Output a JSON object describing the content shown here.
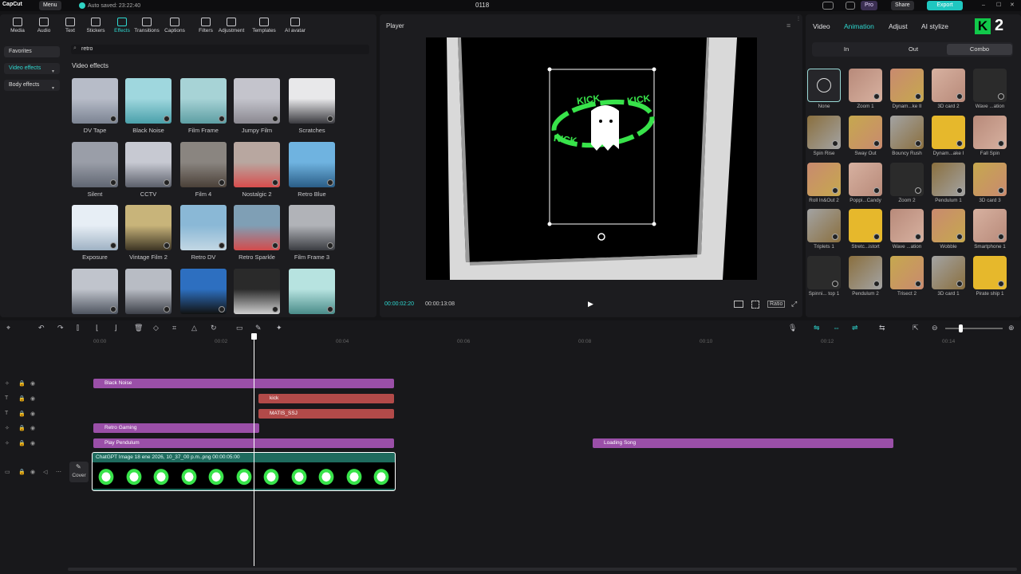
{
  "titlebar": {
    "app_name": "CapCut",
    "menu": "Menu",
    "autosave": "Auto saved: 23:22:40",
    "project": "0118",
    "pro": "Pro",
    "share": "Share",
    "export": "Export"
  },
  "toolbar": {
    "tools": [
      "Media",
      "Audio",
      "Text",
      "Stickers",
      "Effects",
      "Transitions",
      "Captions",
      "Filters",
      "Adjustment",
      "Templates",
      "AI avatar"
    ],
    "active": "Effects"
  },
  "effects_panel": {
    "sidebar": [
      "Favorites",
      "Video effects",
      "Body effects"
    ],
    "search_value": "retro",
    "section_title": "Video effects",
    "items": [
      "DV Tape",
      "Black Noise",
      "Film Frame",
      "Jumpy Film",
      "Scratches",
      "Silent",
      "CCTV",
      "Film 4",
      "Nostalgic 2",
      "Retro Blue",
      "Exposure",
      "Vintage Film 2",
      "Retro DV",
      "Retro Sparkle",
      "Film Frame 3"
    ]
  },
  "player": {
    "title": "Player",
    "current_time": "00:00:02:20",
    "total_time": "00:00:13:08",
    "ratio": "Ratio",
    "canvas_text": "KICK"
  },
  "right_panel": {
    "tabs": [
      "Video",
      "Animation",
      "Adjust",
      "AI stylize"
    ],
    "active_tab": "Animation",
    "subtabs": [
      "In",
      "Out",
      "Combo"
    ],
    "active_subtab": "Combo",
    "badge": "2",
    "animations": [
      "None",
      "Zoom 1",
      "Dynam...ke II",
      "3D card 2",
      "Wave ...ation",
      "Spin Rise",
      "Sway Out",
      "Bouncy Rush",
      "Dynam...ake I",
      "Fall Spin",
      "Roll In&Out 2",
      "Poppi...Candy",
      "Zoom 2",
      "Pendulum 1",
      "3D card 3",
      "Triplets 1",
      "Stretc...istort",
      "Wave ...ation",
      "Wobble",
      "Smartphone 1",
      "Spinni... top 1",
      "Pendulum 2",
      "Trisect 2",
      "3D card 1",
      "Pirate ship 1"
    ]
  },
  "timeline": {
    "ruler": [
      "00:00",
      "00:02",
      "00:04",
      "00:06",
      "00:08",
      "00:10",
      "00:12",
      "00:14"
    ],
    "cover": "Cover",
    "clips": {
      "black_noise": "Black Noise",
      "kick": "kick",
      "matis": "MATIS_SSJ",
      "retro_gaming": "Retro Gaming",
      "play_pendulum": "Play Pendulum",
      "loading_song": "Loading Song",
      "main_video": "ChatGPT Image 18 ene 2026, 10_37_00 p.m..png  00:00:05:00"
    }
  },
  "colors": {
    "accent": "#2ed8d0",
    "effect_clip": "#9a4fa8",
    "text_clip": "#b24a49",
    "video_clip": "#1f6b5e"
  }
}
